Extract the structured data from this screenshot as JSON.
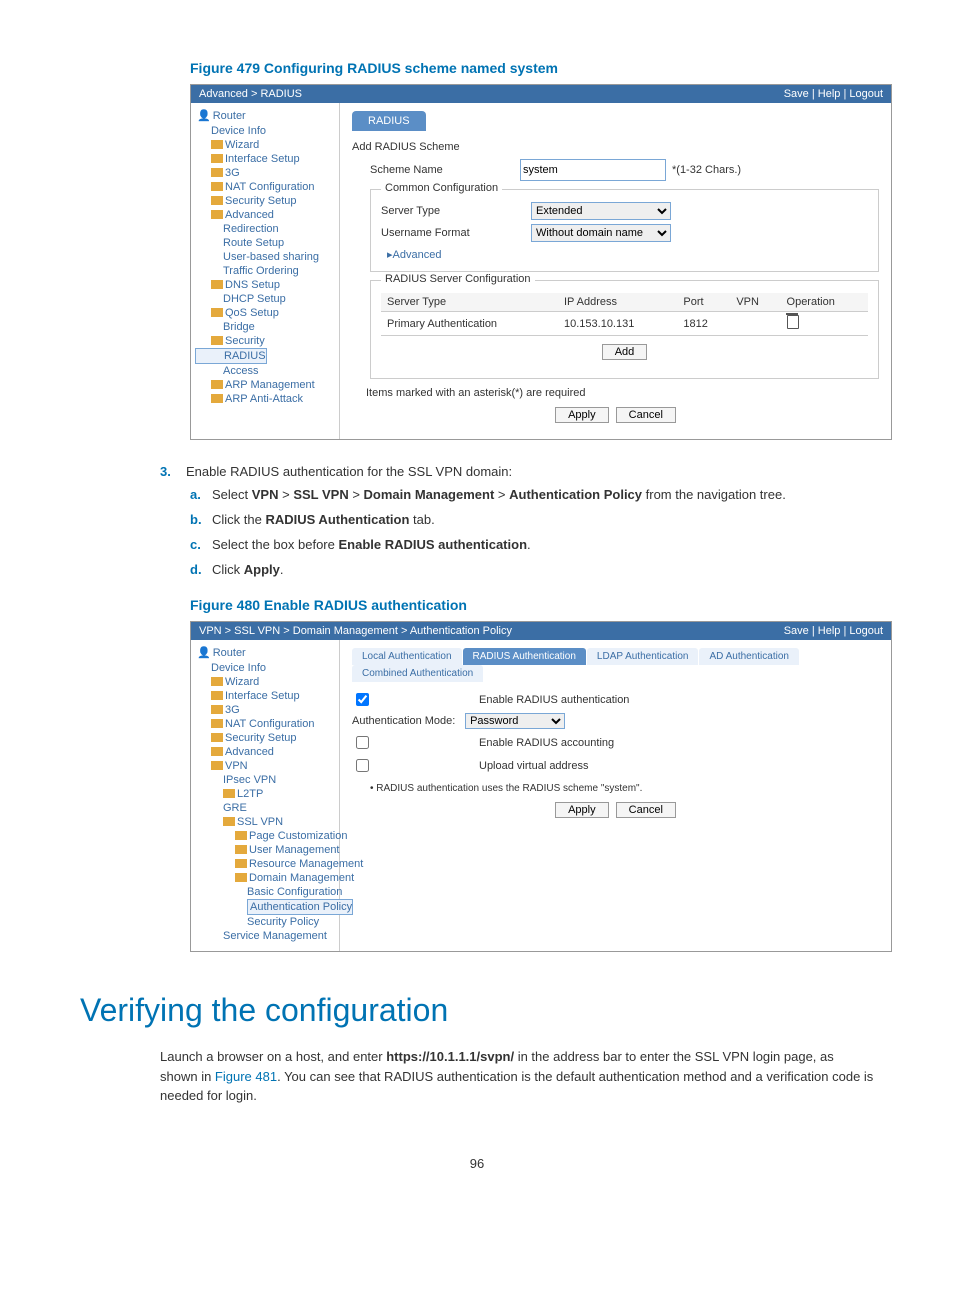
{
  "figure479": {
    "caption": "Figure 479 Configuring RADIUS scheme named system",
    "breadcrumb": "Advanced > RADIUS",
    "topLinks": "Save | Help | Logout",
    "nav": [
      "Router",
      "Device Info",
      "Wizard",
      "Interface Setup",
      "3G",
      "NAT Configuration",
      "Security Setup",
      "Advanced",
      "Redirection",
      "Route Setup",
      "User-based sharing",
      "Traffic Ordering",
      "DNS Setup",
      "DHCP Setup",
      "QoS Setup",
      "Bridge",
      "Security",
      "RADIUS",
      "Access",
      "ARP Management",
      "ARP Anti-Attack"
    ],
    "tab": "RADIUS",
    "sectionTitle": "Add RADIUS Scheme",
    "schemeName": {
      "label": "Scheme Name",
      "value": "system",
      "hint": "*(1-32 Chars.)"
    },
    "common": {
      "legend": "Common Configuration",
      "serverType": {
        "label": "Server Type",
        "value": "Extended"
      },
      "userFormat": {
        "label": "Username Format",
        "value": "Without domain name"
      },
      "advanced": "▸Advanced"
    },
    "serverCfg": {
      "legend": "RADIUS Server Configuration",
      "headers": [
        "Server Type",
        "IP Address",
        "Port",
        "VPN",
        "Operation"
      ],
      "rows": [
        {
          "type": "Primary Authentication",
          "ip": "10.153.10.131",
          "port": "1812",
          "vpn": ""
        }
      ],
      "addBtn": "Add"
    },
    "requiredNote": "Items marked with an asterisk(*) are required",
    "applyBtn": "Apply",
    "cancelBtn": "Cancel"
  },
  "step3": {
    "number": "3.",
    "text": "Enable RADIUS authentication for the SSL VPN domain:",
    "a": {
      "let": "a.",
      "before": "Select ",
      "bolds": [
        "VPN",
        "SSL VPN",
        "Domain Management",
        "Authentication Policy"
      ],
      "sep": " > ",
      "after": " from the navigation tree."
    },
    "b": {
      "let": "b.",
      "before": "Click the ",
      "bold": "RADIUS Authentication",
      "after": " tab."
    },
    "c": {
      "let": "c.",
      "before": "Select the box before ",
      "bold": "Enable RADIUS authentication",
      "after": "."
    },
    "d": {
      "let": "d.",
      "before": "Click ",
      "bold": "Apply",
      "after": "."
    }
  },
  "figure480": {
    "caption": "Figure 480 Enable RADIUS authentication",
    "breadcrumb": "VPN > SSL VPN > Domain Management > Authentication Policy",
    "topLinks": "Save | Help | Logout",
    "nav": [
      "Router",
      "Device Info",
      "Wizard",
      "Interface Setup",
      "3G",
      "NAT Configuration",
      "Security Setup",
      "Advanced",
      "VPN",
      "IPsec VPN",
      "L2TP",
      "GRE",
      "SSL VPN",
      "Page Customization",
      "User Management",
      "Resource Management",
      "Domain Management",
      "Basic Configuration",
      "Authentication Policy",
      "Security Policy",
      "Service Management"
    ],
    "tabs": [
      "Local Authentication",
      "RADIUS Authentication",
      "LDAP Authentication",
      "AD Authentication",
      "Combined Authentication"
    ],
    "activeTab": "RADIUS Authentication",
    "enableRadius": "Enable RADIUS authentication",
    "authModeLabel": "Authentication Mode:",
    "authModeValue": "Password",
    "enableAccounting": "Enable RADIUS accounting",
    "uploadVirtual": "Upload virtual address",
    "bulletNote": "RADIUS authentication uses the RADIUS scheme \"system\".",
    "applyBtn": "Apply",
    "cancelBtn": "Cancel"
  },
  "verifySection": {
    "heading": "Verifying the configuration",
    "p_before": "Launch a browser on a host, and enter ",
    "p_bold": "https://10.1.1.1/svpn/",
    "p_mid": " in the address bar to enter the SSL VPN login page, as shown in ",
    "p_link": "Figure 481",
    "p_after": ". You can see that RADIUS authentication is the default authentication method and a verification code is needed for login."
  },
  "pageNumber": "96"
}
